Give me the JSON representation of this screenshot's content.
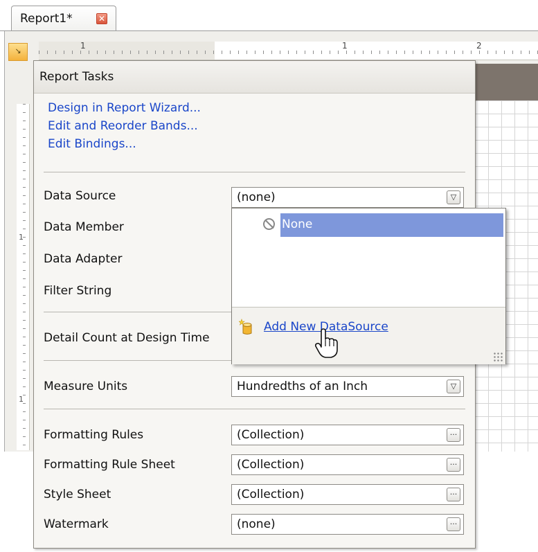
{
  "tab": {
    "title": "Report1*",
    "close_symbol": "✕"
  },
  "ruler": {
    "numbers": [
      "1",
      "1",
      "2"
    ],
    "vertical_numbers": [
      "1",
      "1"
    ]
  },
  "panel": {
    "title": "Report Tasks",
    "links": [
      {
        "label": "Design in Report Wizard..."
      },
      {
        "label": "Edit and Reorder Bands..."
      },
      {
        "label": "Edit Bindings..."
      }
    ],
    "fields": {
      "data_source": {
        "label": "Data Source",
        "value": "(none)"
      },
      "data_member": {
        "label": "Data Member"
      },
      "data_adapter": {
        "label": "Data Adapter"
      },
      "filter_string": {
        "label": "Filter String"
      },
      "detail_count": {
        "label": "Detail Count at Design Time"
      },
      "measure_units": {
        "label": "Measure Units",
        "value": "Hundredths of an Inch"
      },
      "formatting_rules": {
        "label": "Formatting Rules",
        "value": "(Collection)"
      },
      "formatting_rule_sheet": {
        "label": "Formatting Rule Sheet",
        "value": "(Collection)"
      },
      "style_sheet": {
        "label": "Style Sheet",
        "value": "(Collection)"
      },
      "watermark": {
        "label": "Watermark",
        "value": "(none)"
      }
    },
    "ellipsis": "···",
    "dropdown_arrow": "▽"
  },
  "dropdown": {
    "items": [
      {
        "label": "None",
        "icon": "none-icon",
        "selected": true
      }
    ],
    "add_link": "Add New DataSource"
  },
  "colors": {
    "selection": "#7e97db",
    "link": "#1a46c9",
    "band_header": "#7d746c",
    "corner_button": "#f4b23c"
  }
}
